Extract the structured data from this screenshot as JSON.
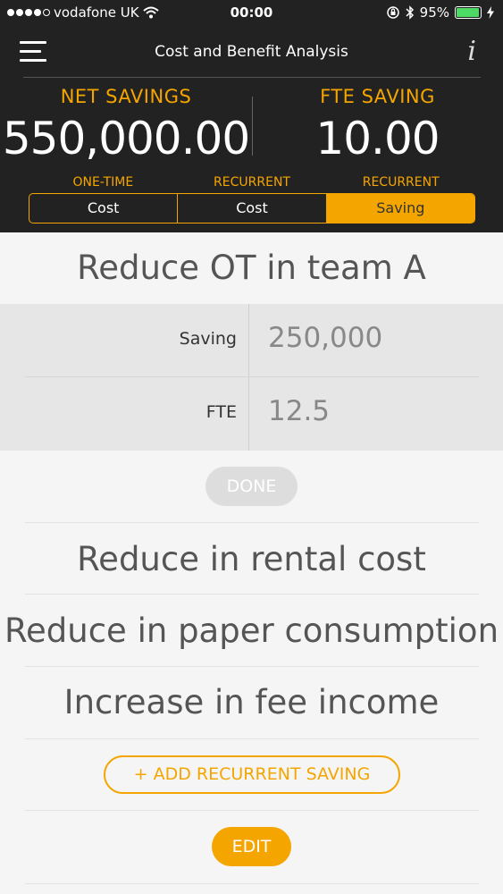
{
  "status_bar": {
    "carrier": "vodafone UK",
    "time": "00:00",
    "battery_percent": "95%",
    "battery_level": 0.95,
    "battery_color": "#4cd964",
    "icons": [
      "signal-dots-icon",
      "wifi-icon",
      "orientation-lock-icon",
      "bluetooth-icon",
      "battery-icon",
      "charging-bolt-icon"
    ]
  },
  "nav": {
    "title": "Cost and Benefit Analysis",
    "menu_icon": "hamburger-menu-icon",
    "info_icon": "info-icon",
    "info_glyph": "i"
  },
  "summary": {
    "net_savings_label": "NET SAVINGS",
    "net_savings_value": "550,000.00",
    "fte_saving_label": "FTE SAVING",
    "fte_saving_value": "10.00"
  },
  "segments": [
    {
      "top_label": "ONE-TIME",
      "label": "Cost",
      "active": false
    },
    {
      "top_label": "RECURRENT",
      "label": "Cost",
      "active": false
    },
    {
      "top_label": "RECURRENT",
      "label": "Saving",
      "active": true
    }
  ],
  "selected_item": {
    "title": "Reduce OT in team A",
    "fields": [
      {
        "label": "Saving",
        "value": "250,000"
      },
      {
        "label": "FTE",
        "value": "12.5"
      }
    ],
    "done_label": "DONE"
  },
  "items": [
    {
      "title": "Reduce in rental cost"
    },
    {
      "title": "Reduce in paper consumption"
    },
    {
      "title": "Increase in fee income"
    }
  ],
  "add_button_label": "+ ADD RECURRENT SAVING",
  "edit_button_label": "EDIT",
  "colors": {
    "accent": "#f5a500",
    "header_bg": "#222222",
    "body_bg": "#f5f5f5",
    "editor_bg": "#e6e6e6"
  }
}
